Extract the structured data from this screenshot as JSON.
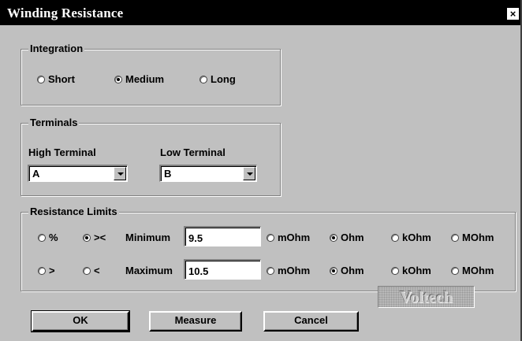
{
  "window": {
    "title": "Winding Resistance",
    "close_glyph": "×"
  },
  "integration": {
    "legend": "Integration",
    "options": [
      {
        "label": "Short",
        "selected": false
      },
      {
        "label": "Medium",
        "selected": true
      },
      {
        "label": "Long",
        "selected": false
      }
    ]
  },
  "terminals": {
    "legend": "Terminals",
    "high_label": "High Terminal",
    "high_value": "A",
    "low_label": "Low Terminal",
    "low_value": "B"
  },
  "limits": {
    "legend": "Resistance Limits",
    "mode_options": [
      {
        "label": "%",
        "selected": false
      },
      {
        "label": "><",
        "selected": true
      },
      {
        "label": ">",
        "selected": false
      },
      {
        "label": "<",
        "selected": false
      }
    ],
    "minimum": {
      "label": "Minimum",
      "value": "9.5",
      "units": [
        {
          "label": "mOhm",
          "selected": false
        },
        {
          "label": "Ohm",
          "selected": true
        },
        {
          "label": "kOhm",
          "selected": false
        },
        {
          "label": "MOhm",
          "selected": false
        }
      ]
    },
    "maximum": {
      "label": "Maximum",
      "value": "10.5",
      "units": [
        {
          "label": "mOhm",
          "selected": false
        },
        {
          "label": "Ohm",
          "selected": true
        },
        {
          "label": "kOhm",
          "selected": false
        },
        {
          "label": "MOhm",
          "selected": false
        }
      ]
    }
  },
  "buttons": {
    "ok": "OK",
    "measure": "Measure",
    "cancel": "Cancel"
  },
  "logo": {
    "text": "Voltech"
  },
  "colors": {
    "face": "#c0c0c0",
    "title_bar": "#000000",
    "title_text": "#ffffff"
  }
}
